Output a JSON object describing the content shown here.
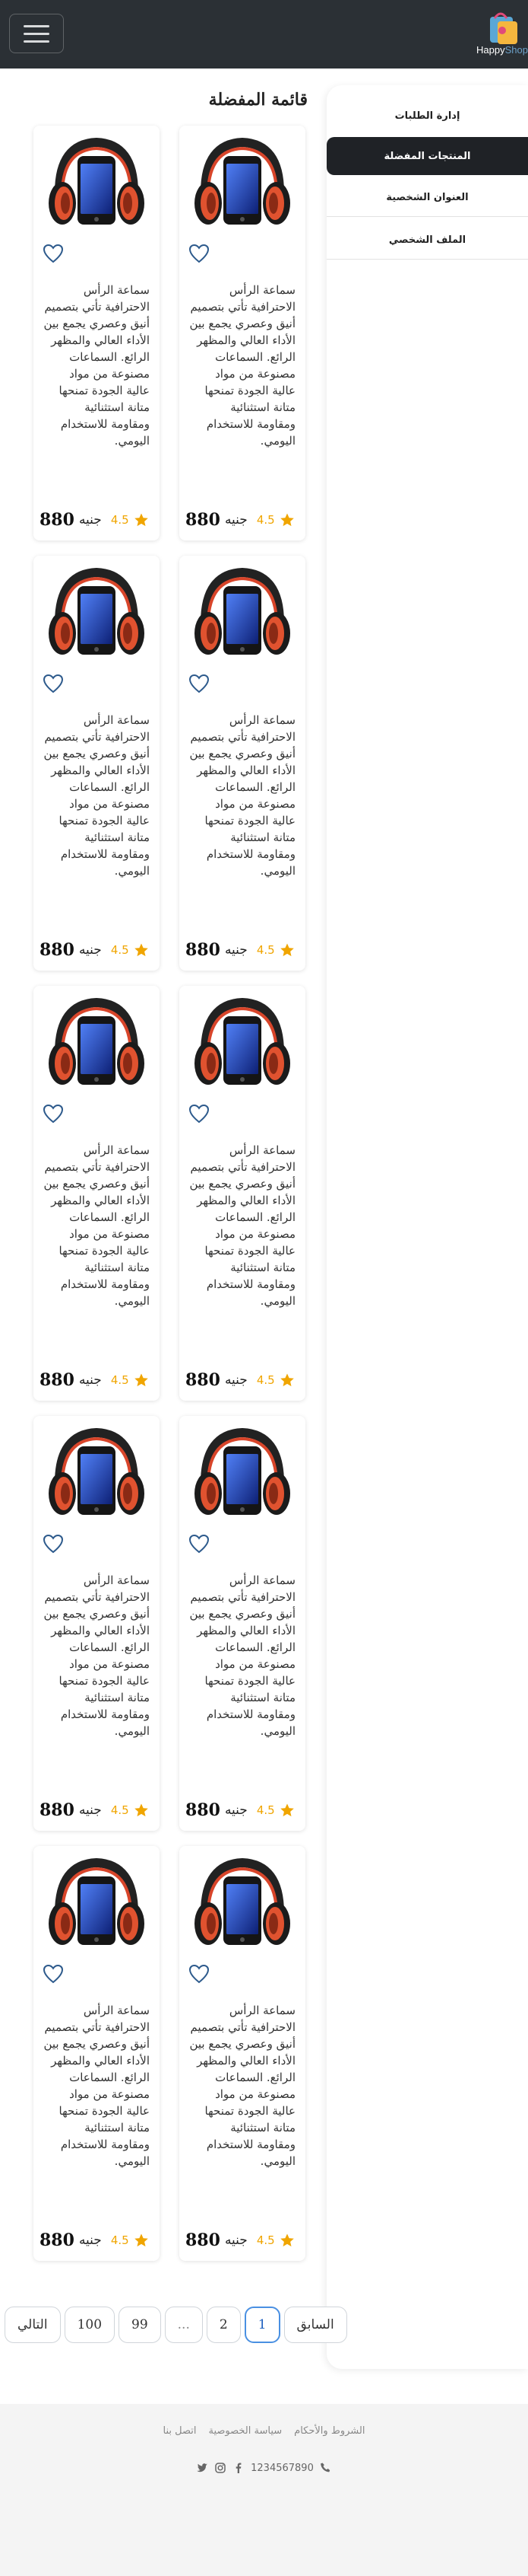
{
  "header": {
    "logo_text_a": "Happy",
    "logo_text_b": "Shop"
  },
  "sidebar": {
    "items": [
      {
        "label": "إدارة الطلبات"
      },
      {
        "label": "المنتجات المفضلة",
        "active": true
      },
      {
        "label": "العنوان الشخصية"
      },
      {
        "label": "الملف الشخصي"
      }
    ]
  },
  "favorites": {
    "title": "قائمة المفضلة",
    "products": [
      {
        "description": "سماعة الرأس الاحترافية تأتي بتصميم أنيق وعصري يجمع بين الأداء العالي والمظهر الرائع. السماعات مصنوعة من مواد عالية الجودة تمنحها متانة استثنائية ومقاومة للاستخدام اليومي.",
        "price": "880",
        "currency": "جنيه",
        "rating": "4.5"
      },
      {
        "description": "سماعة الرأس الاحترافية تأتي بتصميم أنيق وعصري يجمع بين الأداء العالي والمظهر الرائع. السماعات مصنوعة من مواد عالية الجودة تمنحها متانة استثنائية ومقاومة للاستخدام اليومي.",
        "price": "880",
        "currency": "جنيه",
        "rating": "4.5"
      },
      {
        "description": "سماعة الرأس الاحترافية تأتي بتصميم أنيق وعصري يجمع بين الأداء العالي والمظهر الرائع. السماعات مصنوعة من مواد عالية الجودة تمنحها متانة استثنائية ومقاومة للاستخدام اليومي.",
        "price": "880",
        "currency": "جنيه",
        "rating": "4.5"
      },
      {
        "description": "سماعة الرأس الاحترافية تأتي بتصميم أنيق وعصري يجمع بين الأداء العالي والمظهر الرائع. السماعات مصنوعة من مواد عالية الجودة تمنحها متانة استثنائية ومقاومة للاستخدام اليومي.",
        "price": "880",
        "currency": "جنيه",
        "rating": "4.5"
      },
      {
        "description": "سماعة الرأس الاحترافية تأتي بتصميم أنيق وعصري يجمع بين الأداء العالي والمظهر الرائع. السماعات مصنوعة من مواد عالية الجودة تمنحها متانة استثنائية ومقاومة للاستخدام اليومي.",
        "price": "880",
        "currency": "جنيه",
        "rating": "4.5"
      },
      {
        "description": "سماعة الرأس الاحترافية تأتي بتصميم أنيق وعصري يجمع بين الأداء العالي والمظهر الرائع. السماعات مصنوعة من مواد عالية الجودة تمنحها متانة استثنائية ومقاومة للاستخدام اليومي.",
        "price": "880",
        "currency": "جنيه",
        "rating": "4.5"
      },
      {
        "description": "سماعة الرأس الاحترافية تأتي بتصميم أنيق وعصري يجمع بين الأداء العالي والمظهر الرائع. السماعات مصنوعة من مواد عالية الجودة تمنحها متانة استثنائية ومقاومة للاستخدام اليومي.",
        "price": "880",
        "currency": "جنيه",
        "rating": "4.5"
      },
      {
        "description": "سماعة الرأس الاحترافية تأتي بتصميم أنيق وعصري يجمع بين الأداء العالي والمظهر الرائع. السماعات مصنوعة من مواد عالية الجودة تمنحها متانة استثنائية ومقاومة للاستخدام اليومي.",
        "price": "880",
        "currency": "جنيه",
        "rating": "4.5"
      },
      {
        "description": "سماعة الرأس الاحترافية تأتي بتصميم أنيق وعصري يجمع بين الأداء العالي والمظهر الرائع. السماعات مصنوعة من مواد عالية الجودة تمنحها متانة استثنائية ومقاومة للاستخدام اليومي.",
        "price": "880",
        "currency": "جنيه",
        "rating": "4.5"
      },
      {
        "description": "سماعة الرأس الاحترافية تأتي بتصميم أنيق وعصري يجمع بين الأداء العالي والمظهر الرائع. السماعات مصنوعة من مواد عالية الجودة تمنحها متانة استثنائية ومقاومة للاستخدام اليومي.",
        "price": "880",
        "currency": "جنيه",
        "rating": "4.5"
      }
    ]
  },
  "pagination": {
    "prev": "السابق",
    "pages": [
      "1",
      "2",
      "...",
      "99",
      "100"
    ],
    "next": "التالي",
    "active_page": "1"
  },
  "footer": {
    "links": [
      "الشروط والأحكام",
      "سياسة الخصوصية",
      "اتصل بنا"
    ],
    "phone": "1234567890",
    "icons": [
      "phone-icon",
      "facebook-icon",
      "instagram-icon",
      "twitter-icon"
    ]
  },
  "colors": {
    "header_bg": "#2b3035",
    "active_sidebar_bg": "#1f2226",
    "star": "#f0a500",
    "active_page_border": "#4a90e2"
  }
}
